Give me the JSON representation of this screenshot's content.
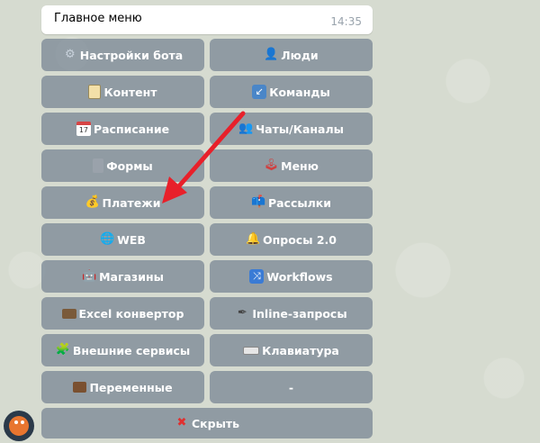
{
  "message": {
    "title": "Главное меню",
    "time": "14:35"
  },
  "keyboard": {
    "rows": [
      [
        {
          "icon": "gear-icon",
          "glyph": "⚙",
          "label": "Настройки бота"
        },
        {
          "icon": "person-icon",
          "glyph": "👤",
          "label": "Люди"
        }
      ],
      [
        {
          "icon": "clipboard-icon",
          "glyph": "",
          "label": "Контент"
        },
        {
          "icon": "arrow-box-icon",
          "glyph": "↙",
          "label": "Команды"
        }
      ],
      [
        {
          "icon": "calendar-icon",
          "glyph": "17",
          "label": "Расписание"
        },
        {
          "icon": "people-icon",
          "glyph": "👥",
          "label": "Чаты/Каналы"
        }
      ],
      [
        {
          "icon": "file-cabinet-icon",
          "glyph": "",
          "label": "Формы"
        },
        {
          "icon": "joystick-icon",
          "glyph": "🕹",
          "label": "Меню"
        }
      ],
      [
        {
          "icon": "money-bag-icon",
          "glyph": "💰",
          "label": "Платежи"
        },
        {
          "icon": "mailbox-icon",
          "glyph": "📫",
          "label": "Рассылки"
        }
      ],
      [
        {
          "icon": "globe-icon",
          "glyph": "🌐",
          "label": "WEB"
        },
        {
          "icon": "bell-icon",
          "glyph": "🔔",
          "label": "Опросы 2.0"
        }
      ],
      [
        {
          "icon": "robot-icon",
          "glyph": "🤖",
          "label": "Магазины"
        },
        {
          "icon": "shuffle-icon",
          "glyph": "⤨",
          "label": "Workflows"
        }
      ],
      [
        {
          "icon": "credit-card-icon",
          "glyph": "",
          "label": "Excel конвертор"
        },
        {
          "icon": "pen-icon",
          "glyph": "✒",
          "label": "Inline-запросы"
        }
      ],
      [
        {
          "icon": "puzzle-icon",
          "glyph": "🧩",
          "label": "Внешние сервисы"
        },
        {
          "icon": "keyboard-icon",
          "glyph": "",
          "label": "Клавиатура"
        }
      ],
      [
        {
          "icon": "briefcase-icon",
          "glyph": "",
          "label": "Переменные"
        },
        {
          "icon": "",
          "glyph": "",
          "label": "-"
        }
      ],
      [
        {
          "icon": "cross-icon",
          "glyph": "✖",
          "label": "Скрыть"
        }
      ]
    ]
  },
  "colors": {
    "button_bg": "#748292",
    "annotation_arrow": "#e8202a"
  }
}
